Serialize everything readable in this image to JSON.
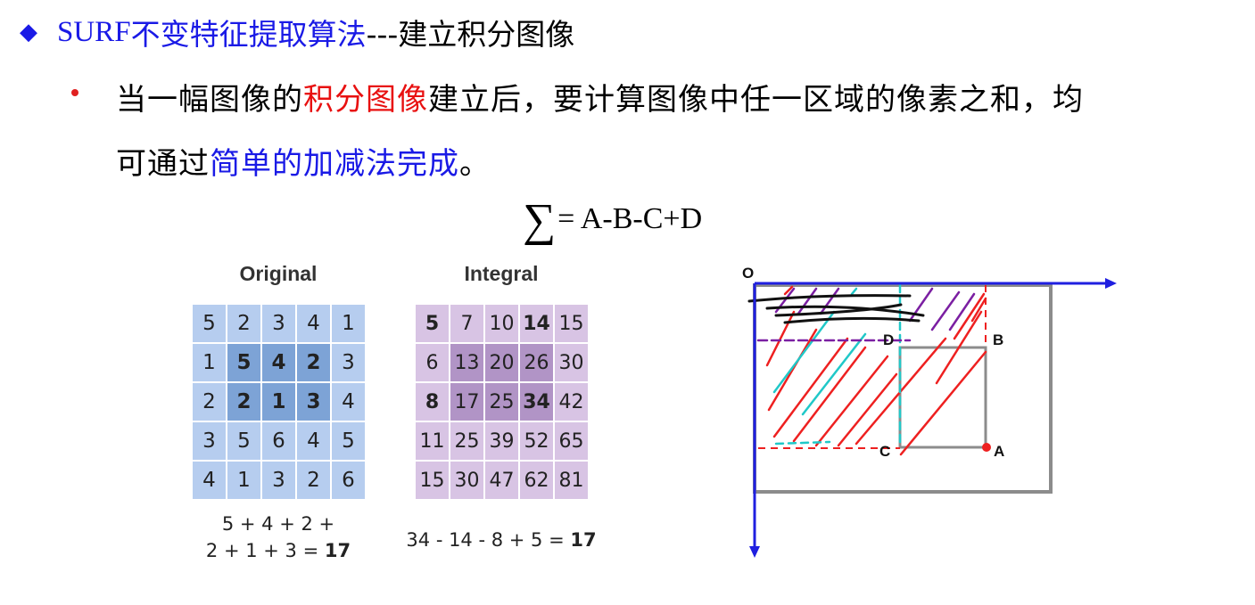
{
  "heading": {
    "marker": "◆",
    "surf": "SURF",
    "blue_text": "不变特征提取算法",
    "black_text": "---建立积分图像"
  },
  "paragraph": {
    "line1_part1": "当一幅图像的",
    "line1_red": "积分图像",
    "line1_part2": "建立后，要计算图像中任一区域的像素之和，均",
    "line2_part1": "可通过",
    "line2_blue": "简单的加减法完成",
    "line2_part2": "。"
  },
  "formula": {
    "sigma": "∑",
    "expr": "= A-B-C+D"
  },
  "original": {
    "title": "Original",
    "rows": [
      [
        "5",
        "2",
        "3",
        "4",
        "1"
      ],
      [
        "1",
        "5",
        "4",
        "2",
        "3"
      ],
      [
        "2",
        "2",
        "1",
        "3",
        "4"
      ],
      [
        "3",
        "5",
        "6",
        "4",
        "5"
      ],
      [
        "4",
        "1",
        "3",
        "2",
        "6"
      ]
    ],
    "sum_line1": "5 + 4 + 2 +",
    "sum_line2_prefix": "2 + 1 + 3 = ",
    "sum_result": "17"
  },
  "integral": {
    "title": "Integral",
    "rows": [
      [
        "5",
        "7",
        "10",
        "14",
        "15"
      ],
      [
        "6",
        "13",
        "20",
        "26",
        "30"
      ],
      [
        "8",
        "17",
        "25",
        "34",
        "42"
      ],
      [
        "11",
        "25",
        "39",
        "52",
        "65"
      ],
      [
        "15",
        "30",
        "47",
        "62",
        "81"
      ]
    ],
    "sum_prefix": "34 - 14 - 8 + 5 = ",
    "sum_result": "17"
  },
  "diagram": {
    "origin_label": "O",
    "label_a": "A",
    "label_b": "B",
    "label_c": "C",
    "label_d": "D",
    "axis_color": "#1f1fe0",
    "box_color": "#8c8c8c"
  }
}
